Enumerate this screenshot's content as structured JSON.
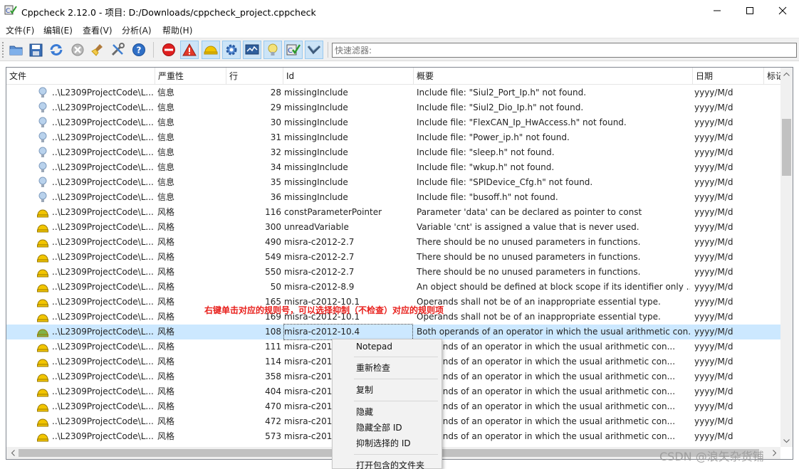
{
  "window": {
    "title": "Cppcheck 2.12.0 - 项目: D:/Downloads/cppcheck_project.cppcheck"
  },
  "menu": [
    {
      "label": "文件(F)"
    },
    {
      "label": "编辑(E)"
    },
    {
      "label": "查看(V)"
    },
    {
      "label": "分析(A)"
    },
    {
      "label": "帮助(H)"
    }
  ],
  "toolbar": {
    "icons": [
      "open-folder-icon",
      "save-icon",
      "recheck-icon",
      "stop-icon",
      "clear-icon",
      "settings-tools-icon",
      "help-icon",
      "show-errors-icon",
      "show-warnings-icon",
      "show-style-icon",
      "show-performance-icon",
      "show-portability-icon",
      "show-information-icon",
      "cppcheck-logo-icon",
      "show-c-icon"
    ],
    "filter_placeholder": "快速滤器:"
  },
  "table": {
    "columns": [
      "文件",
      "严重性",
      "行",
      "Id",
      "概要",
      "日期",
      "标记"
    ],
    "rows": [
      {
        "icon": "info",
        "file": "..\\L2309ProjectCode\\L...",
        "severity": "信息",
        "line": "28",
        "id": "missingInclude",
        "summary": "Include file: \"Siul2_Port_Ip.h\" not found.",
        "date": "yyyy/M/d"
      },
      {
        "icon": "info",
        "file": "..\\L2309ProjectCode\\L...",
        "severity": "信息",
        "line": "29",
        "id": "missingInclude",
        "summary": "Include file: \"Siul2_Dio_Ip.h\" not found.",
        "date": "yyyy/M/d"
      },
      {
        "icon": "info",
        "file": "..\\L2309ProjectCode\\L...",
        "severity": "信息",
        "line": "30",
        "id": "missingInclude",
        "summary": "Include file: \"FlexCAN_Ip_HwAccess.h\" not found.",
        "date": "yyyy/M/d"
      },
      {
        "icon": "info",
        "file": "..\\L2309ProjectCode\\L...",
        "severity": "信息",
        "line": "31",
        "id": "missingInclude",
        "summary": "Include file: \"Power_ip.h\" not found.",
        "date": "yyyy/M/d"
      },
      {
        "icon": "info",
        "file": "..\\L2309ProjectCode\\L...",
        "severity": "信息",
        "line": "32",
        "id": "missingInclude",
        "summary": "Include file: \"sleep.h\" not found.",
        "date": "yyyy/M/d"
      },
      {
        "icon": "info",
        "file": "..\\L2309ProjectCode\\L...",
        "severity": "信息",
        "line": "34",
        "id": "missingInclude",
        "summary": "Include file: \"wkup.h\" not found.",
        "date": "yyyy/M/d"
      },
      {
        "icon": "info",
        "file": "..\\L2309ProjectCode\\L...",
        "severity": "信息",
        "line": "35",
        "id": "missingInclude",
        "summary": "Include file: \"SPIDevice_Cfg.h\" not found.",
        "date": "yyyy/M/d"
      },
      {
        "icon": "info",
        "file": "..\\L2309ProjectCode\\L...",
        "severity": "信息",
        "line": "36",
        "id": "missingInclude",
        "summary": "Include file: \"busoff.h\" not found.",
        "date": "yyyy/M/d"
      },
      {
        "icon": "style",
        "file": "..\\L2309ProjectCode\\L...",
        "severity": "风格",
        "line": "116",
        "id": "constParameterPointer",
        "summary": "Parameter 'data' can be declared as pointer to const",
        "date": "yyyy/M/d"
      },
      {
        "icon": "style",
        "file": "..\\L2309ProjectCode\\L...",
        "severity": "风格",
        "line": "300",
        "id": "unreadVariable",
        "summary": "Variable 'cnt' is assigned a value that is never used.",
        "date": "yyyy/M/d"
      },
      {
        "icon": "style",
        "file": "..\\L2309ProjectCode\\L...",
        "severity": "风格",
        "line": "490",
        "id": "misra-c2012-2.7",
        "summary": "There should be no unused parameters in functions.",
        "date": "yyyy/M/d"
      },
      {
        "icon": "style",
        "file": "..\\L2309ProjectCode\\L...",
        "severity": "风格",
        "line": "549",
        "id": "misra-c2012-2.7",
        "summary": "There should be no unused parameters in functions.",
        "date": "yyyy/M/d"
      },
      {
        "icon": "style",
        "file": "..\\L2309ProjectCode\\L...",
        "severity": "风格",
        "line": "550",
        "id": "misra-c2012-2.7",
        "summary": "There should be no unused parameters in functions.",
        "date": "yyyy/M/d"
      },
      {
        "icon": "style",
        "file": "..\\L2309ProjectCode\\L...",
        "severity": "风格",
        "line": "50",
        "id": "misra-c2012-8.9",
        "summary": "An object should be defined at block scope if its identifier only ...",
        "date": "yyyy/M/d"
      },
      {
        "icon": "style",
        "file": "..\\L2309ProjectCode\\L...",
        "severity": "风格",
        "line": "165",
        "id": "misra-c2012-10.1",
        "summary": "Operands shall not be of an inappropriate essential type.",
        "date": "yyyy/M/d"
      },
      {
        "icon": "style",
        "file": "..\\L2309ProjectCode\\L...",
        "severity": "风格",
        "line": "169",
        "id": "misra-c2012-10.1",
        "summary": "Operands shall not be of an inappropriate essential type.",
        "date": "yyyy/M/d"
      },
      {
        "icon": "style-selected",
        "file": "..\\L2309ProjectCode\\L...",
        "severity": "风格",
        "line": "108",
        "id": "misra-c2012-10.4",
        "summary": "Both operands of an operator in which the usual arithmetic con...",
        "date": "yyyy/M/d",
        "selected": true
      },
      {
        "icon": "style",
        "file": "..\\L2309ProjectCode\\L...",
        "severity": "风格",
        "line": "111",
        "id": "misra-c201",
        "summary": "Operands of an operator in which the usual arithmetic con...",
        "date": "yyyy/M/d"
      },
      {
        "icon": "style",
        "file": "..\\L2309ProjectCode\\L...",
        "severity": "风格",
        "line": "114",
        "id": "misra-c201",
        "summary": "Operands of an operator in which the usual arithmetic con...",
        "date": "yyyy/M/d"
      },
      {
        "icon": "style",
        "file": "..\\L2309ProjectCode\\L...",
        "severity": "风格",
        "line": "358",
        "id": "misra-c201",
        "summary": "Operands of an operator in which the usual arithmetic con...",
        "date": "yyyy/M/d"
      },
      {
        "icon": "style",
        "file": "..\\L2309ProjectCode\\L...",
        "severity": "风格",
        "line": "404",
        "id": "misra-c201",
        "summary": "Operands of an operator in which the usual arithmetic con...",
        "date": "yyyy/M/d"
      },
      {
        "icon": "style",
        "file": "..\\L2309ProjectCode\\L...",
        "severity": "风格",
        "line": "470",
        "id": "misra-c201",
        "summary": "Operands of an operator in which the usual arithmetic con...",
        "date": "yyyy/M/d"
      },
      {
        "icon": "style",
        "file": "..\\L2309ProjectCode\\L...",
        "severity": "风格",
        "line": "472",
        "id": "misra-c201",
        "summary": "Operands of an operator in which the usual arithmetic con...",
        "date": "yyyy/M/d"
      },
      {
        "icon": "style",
        "file": "..\\L2309ProjectCode\\L...",
        "severity": "风格",
        "line": "573",
        "id": "misra-c201",
        "summary": "Operands of an operator in which the usual arithmetic con...",
        "date": "yyyy/M/d"
      }
    ]
  },
  "annotation": "右键单击对应的规则号，可以选择抑制（不检查）对应的规则项",
  "context_menu": {
    "items": [
      {
        "label": "Notepad"
      },
      {
        "separator": true
      },
      {
        "label": "重新检查"
      },
      {
        "separator": true
      },
      {
        "label": "复制"
      },
      {
        "separator": true
      },
      {
        "label": "隐藏"
      },
      {
        "label": "隐藏全部 ID"
      },
      {
        "label": "抑制选择的 ID"
      },
      {
        "separator": true
      },
      {
        "label": "打开包含的文件夹"
      }
    ]
  },
  "watermark": "CSDN @浪矢杂货铺",
  "colors": {
    "selection": "#cce8ff",
    "annotation": "#e8201c",
    "style_icon": "#f2c500",
    "style_selected_icon": "#7fb24a",
    "info_icon": "#b9d2ec"
  }
}
